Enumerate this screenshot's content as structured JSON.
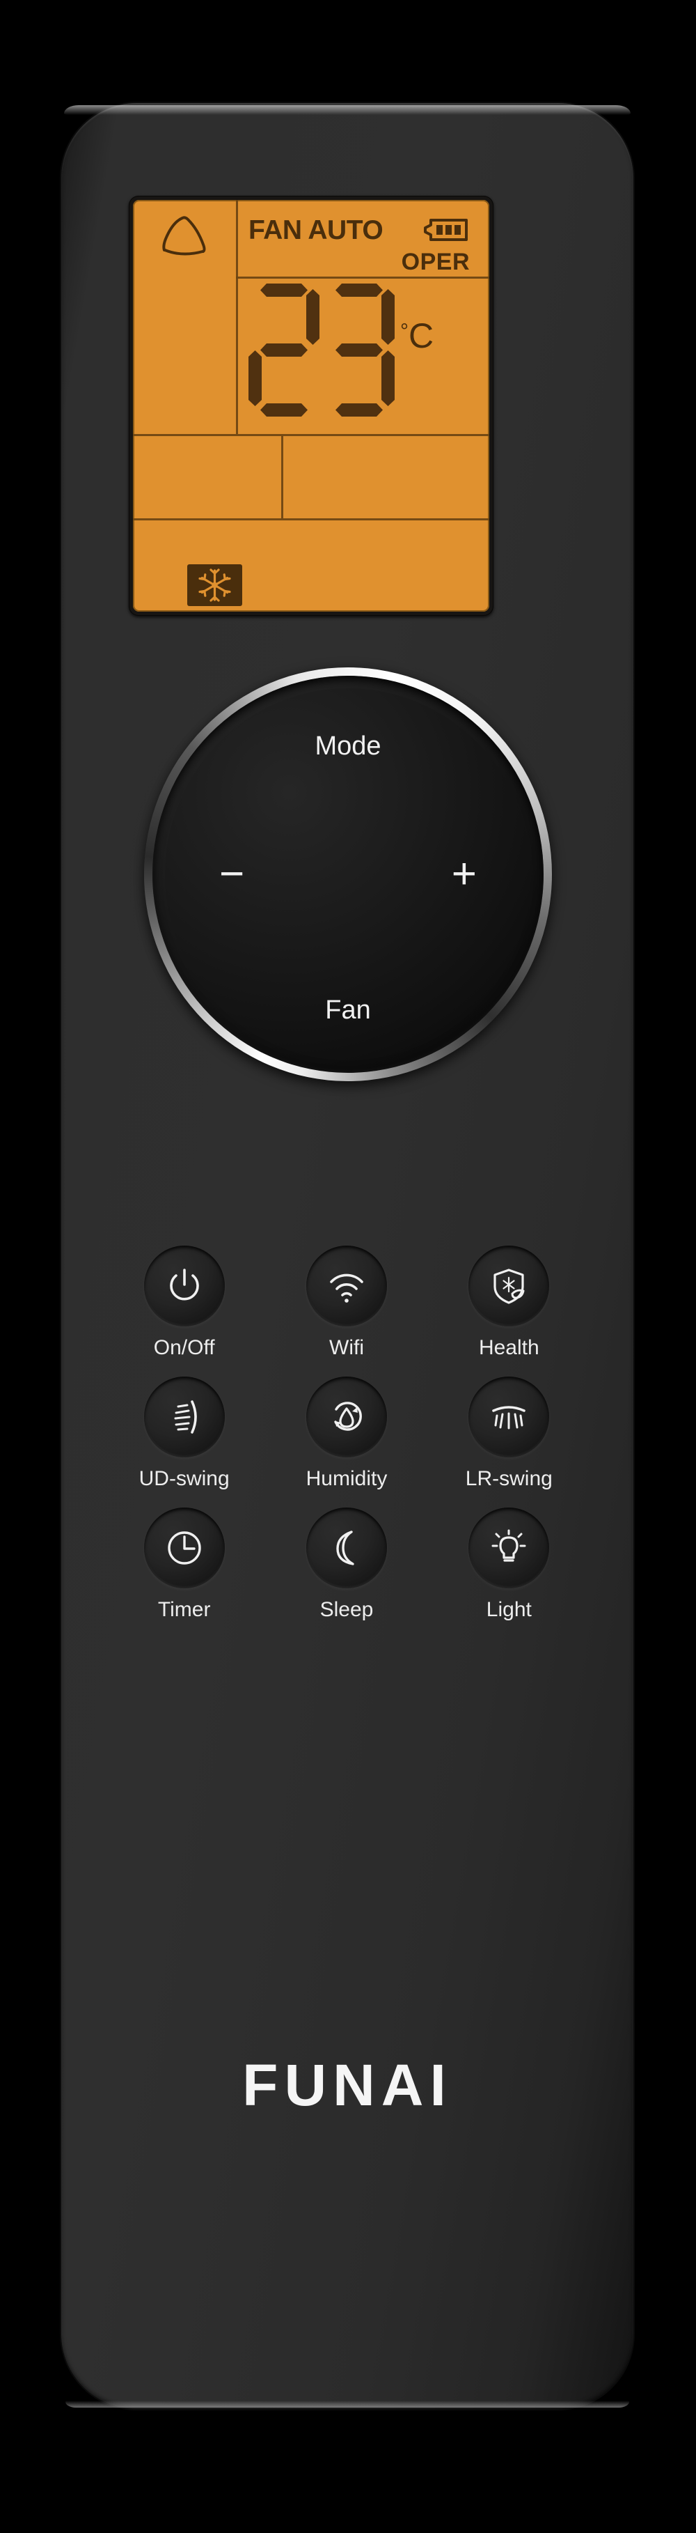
{
  "device": {
    "brand": "FUNAI",
    "type": "air-conditioner-remote-control"
  },
  "display": {
    "fan_label": "FAN AUTO",
    "oper_label": "OPER",
    "temperature": "23",
    "temperature_digits": [
      "2",
      "3"
    ],
    "unit": "°C",
    "unit_degree": "°",
    "unit_letter": "C",
    "signal_icon": "signal-triangle-icon",
    "battery_icon": "battery-full-icon",
    "battery_bars": 3,
    "mode_icon": "snowflake-cool-icon",
    "backlight_color": "#e0912f",
    "segment_color": "#4a2e0c"
  },
  "dial": {
    "mode_label": "Mode",
    "fan_label": "Fan",
    "minus_label": "−",
    "plus_label": "+"
  },
  "buttons": [
    {
      "label": "On/Off",
      "icon": "power-icon"
    },
    {
      "label": "Wifi",
      "icon": "wifi-icon"
    },
    {
      "label": "Health",
      "icon": "shield-leaf-icon"
    },
    {
      "label": "UD-swing",
      "icon": "up-down-swing-icon"
    },
    {
      "label": "Humidity",
      "icon": "water-drop-cycle-icon"
    },
    {
      "label": "LR-swing",
      "icon": "left-right-swing-icon"
    },
    {
      "label": "Timer",
      "icon": "clock-icon"
    },
    {
      "label": "Sleep",
      "icon": "moon-icon"
    },
    {
      "label": "Light",
      "icon": "lightbulb-icon"
    }
  ]
}
